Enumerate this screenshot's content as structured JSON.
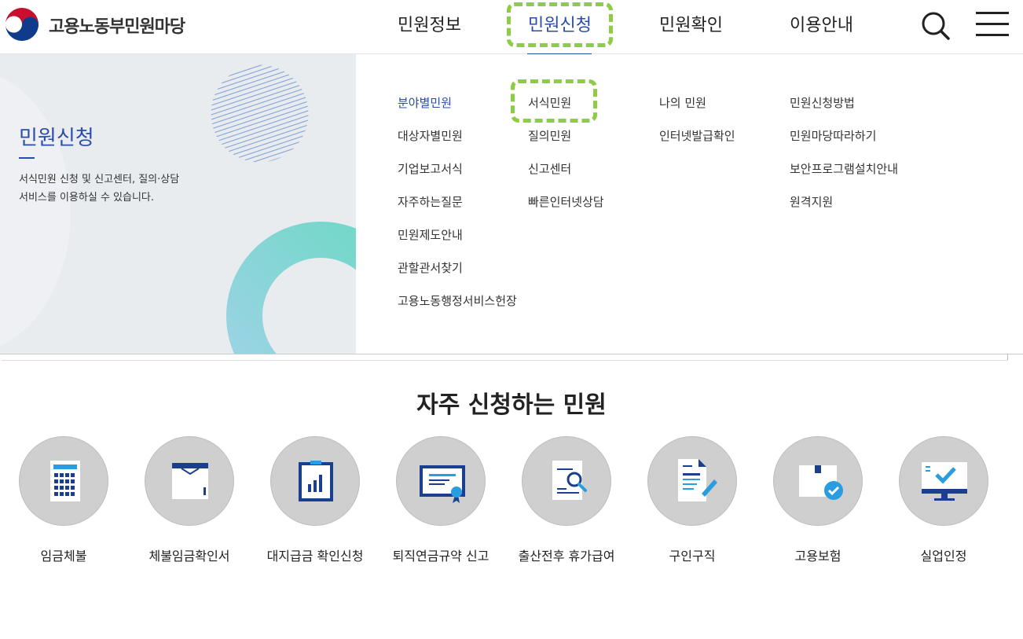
{
  "header": {
    "logo_text": "고용노동부민원마당",
    "nav": [
      "민원정보",
      "민원신청",
      "민원확인",
      "이용안내"
    ]
  },
  "panel": {
    "title": "민원신청",
    "desc_line1": "서식민원 신청 및 신고센터, 질의·상담",
    "desc_line2": "서비스를 이용하실 수 있습니다.",
    "col1": [
      "분야별민원",
      "대상자별민원",
      "기업보고서식",
      "자주하는질문",
      "민원제도안내",
      "관할관서찾기",
      "고용노동행정서비스헌장"
    ],
    "col2": [
      "서식민원",
      "질의민원",
      "신고센터",
      "빠른인터넷상담"
    ],
    "col3": [
      "나의 민원",
      "인터넷발급확인"
    ],
    "col4": [
      "민원신청방법",
      "민원마당따라하기",
      "보안프로그램설치안내",
      "원격지원"
    ]
  },
  "frequent": {
    "title": "자주 신청하는 민원",
    "items": [
      "임금체불",
      "체불임금확인서",
      "대지급금 확인신청",
      "퇴직연금규약 신고",
      "출산전후 휴가급여",
      "구인구직",
      "고용보험",
      "실업인정"
    ]
  },
  "colors": {
    "accent": "#2a4ea8",
    "highlight": "#8fcc46",
    "circle": "#cfcfcf"
  }
}
